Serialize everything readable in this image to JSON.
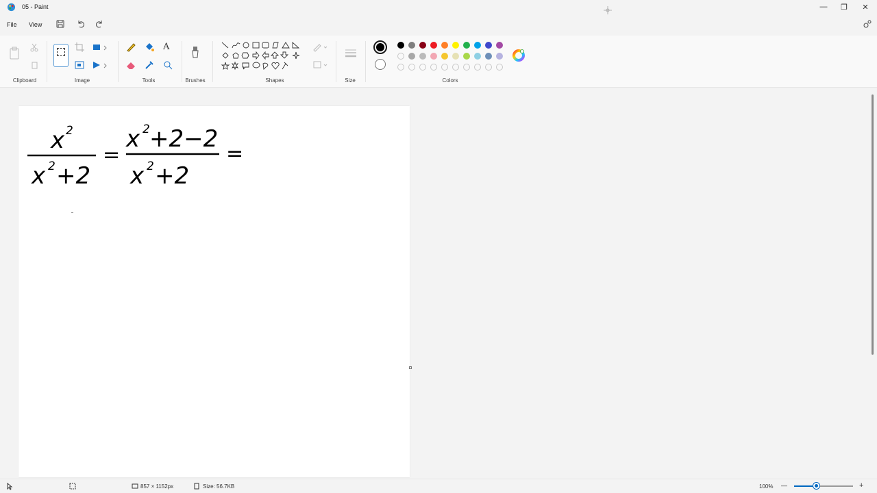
{
  "window": {
    "title": "05 - Paint",
    "minimize_glyph": "—",
    "restore_glyph": "❐",
    "close_glyph": "✕"
  },
  "menu": {
    "file": "File",
    "view": "View"
  },
  "ribbon": {
    "groups": {
      "clipboard": "Clipboard",
      "image": "Image",
      "tools": "Tools",
      "brushes": "Brushes",
      "shapes": "Shapes",
      "size": "Size",
      "colors": "Colors"
    },
    "text_tool_glyph": "A",
    "primary_color": "#000000",
    "secondary_color": "#ffffff",
    "palette_row1": [
      "#000000",
      "#7f7f7f",
      "#880015",
      "#ed1c24",
      "#ff7f27",
      "#fff200",
      "#22b14c",
      "#00a2e8",
      "#3f48cc",
      "#a349a4"
    ],
    "palette_row2": [
      "#ffffff",
      "#c3c3c3",
      "#b97a57",
      "#ffaec9",
      "#ffc90e",
      "#efe4b0",
      "#b5e61d",
      "#99d9ea",
      "#7092be",
      "#c8bfe7"
    ],
    "palette_row2_display": [
      "empty",
      "#a8a8a8",
      "#bbbbbb",
      "#f2a7b3",
      "#f5c62e",
      "#e6e1b4",
      "#a9d84a",
      "#8fd0e4",
      "#6e8fb8",
      "#b6b3e0"
    ]
  },
  "canvas": {
    "math": {
      "lhs_num_base": "x",
      "lhs_num_exp": "2",
      "lhs_den_base": "x",
      "lhs_den_exp": "2",
      "lhs_den_rest": "+2",
      "eq1": "=",
      "rhs_num_base": "x",
      "rhs_num_exp": "2",
      "rhs_num_rest": "+2−2",
      "rhs_den_base": "x",
      "rhs_den_exp": "2",
      "rhs_den_rest": "+2",
      "eq2": "="
    }
  },
  "status": {
    "dimensions": "857 × 1152px",
    "size": "Size: 56.7KB",
    "zoom": "100%",
    "zoom_fraction": 0.38,
    "zoom_minus": "—",
    "zoom_plus": "+"
  }
}
